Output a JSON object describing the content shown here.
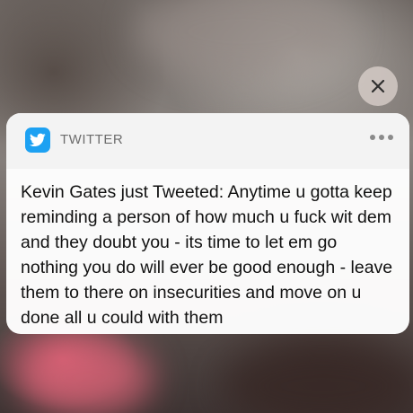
{
  "background": {
    "description_colors": [
      "#6f6864",
      "#d25a6e",
      "#3e3433"
    ]
  },
  "close_button": {
    "icon": "close-icon"
  },
  "notification": {
    "app_icon": "twitter-bird-icon",
    "app_color": "#1da1f2",
    "app_name": "TWITTER",
    "more_icon": "more-dots-icon",
    "message": "Kevin Gates just Tweeted: Anytime u gotta keep reminding a person of how much u fuck wit dem and they doubt you - its time to let em go nothing you do will ever be good enough - leave them to there on insecurities and move on u done all u could with them"
  }
}
